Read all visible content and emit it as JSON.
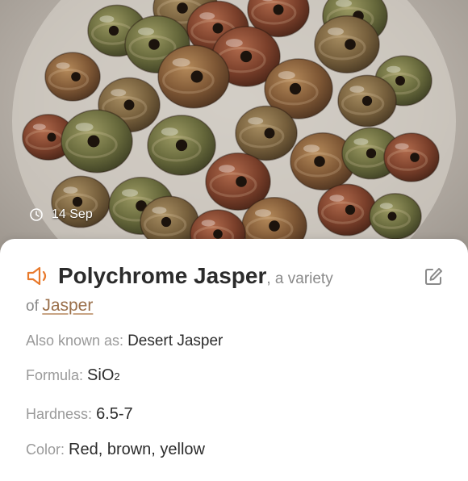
{
  "photo": {
    "date": "14 Sep",
    "date_icon": "clock-icon"
  },
  "mineral": {
    "name": "Polychrome Jasper",
    "variety_prefix": ", a variety",
    "of_prefix": "of",
    "parent": "Jasper"
  },
  "details": {
    "aka_label": "Also known as:",
    "aka_value": "Desert Jasper",
    "formula_label": "Formula:",
    "formula_main": "SiO",
    "formula_sub": "2",
    "hardness_label": "Hardness:",
    "hardness_value": "6.5-7",
    "color_label": "Color:",
    "color_value": "Red, brown, yellow"
  },
  "colors": {
    "accent": "#e8792b",
    "link": "#9a6f4a"
  },
  "icons": {
    "speaker": "speaker-icon",
    "edit": "edit-icon"
  }
}
